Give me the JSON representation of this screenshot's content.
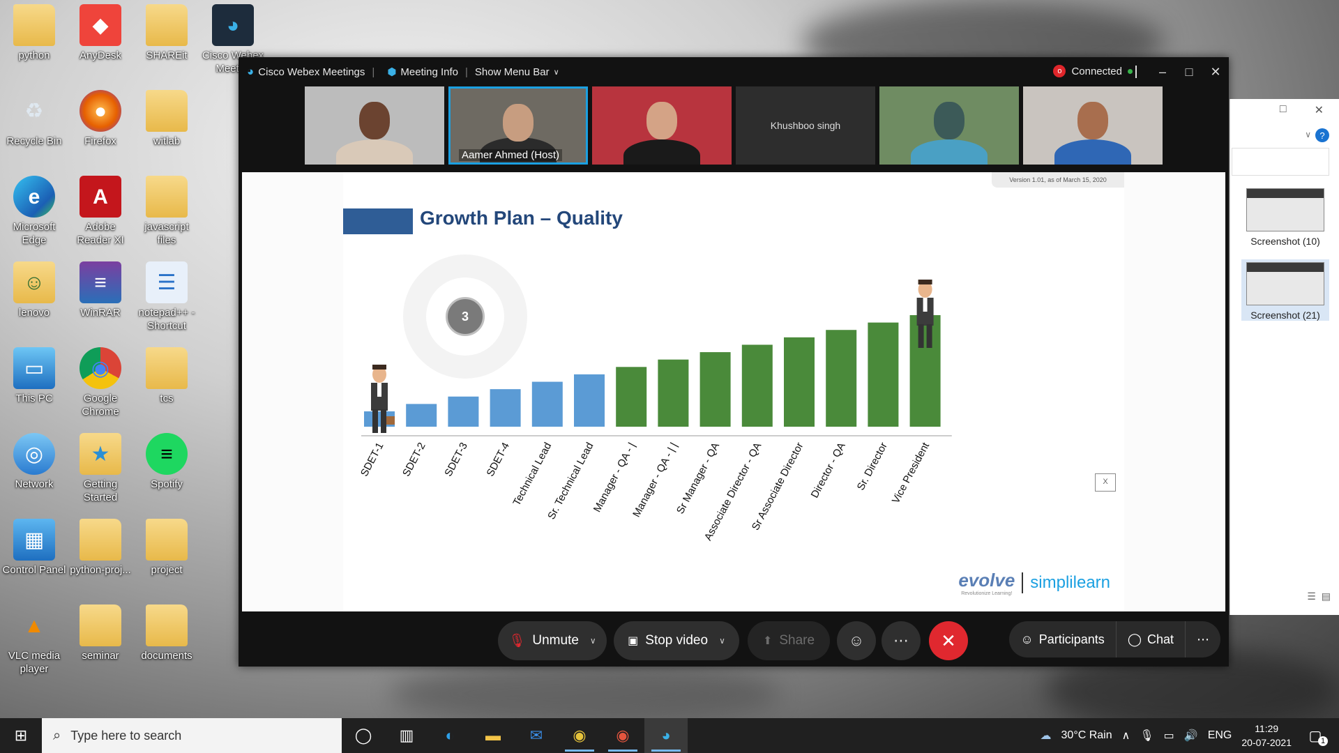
{
  "desktop": {
    "icons": [
      {
        "label": "python",
        "glyph": "folder"
      },
      {
        "label": "AnyDesk",
        "glyph": "anydesk"
      },
      {
        "label": "SHAREit",
        "glyph": "folder"
      },
      {
        "label": "Cisco Webex Meeti...",
        "glyph": "webex"
      },
      {
        "label": "Recycle Bin",
        "glyph": "recycle"
      },
      {
        "label": "Firefox",
        "glyph": "firefox"
      },
      {
        "label": "witlab",
        "glyph": "folder"
      },
      {
        "label": "Microsoft Edge",
        "glyph": "edge"
      },
      {
        "label": "Adobe Reader XI",
        "glyph": "adobe"
      },
      {
        "label": "javascript files",
        "glyph": "folder"
      },
      {
        "label": "lenovo",
        "glyph": "user-folder"
      },
      {
        "label": "WinRAR",
        "glyph": "winrar"
      },
      {
        "label": "notepad++ - Shortcut",
        "glyph": "notepad"
      },
      {
        "label": "This PC",
        "glyph": "pc"
      },
      {
        "label": "Google Chrome",
        "glyph": "chrome"
      },
      {
        "label": "tcs",
        "glyph": "folder"
      },
      {
        "label": "Network",
        "glyph": "network"
      },
      {
        "label": "Getting Started",
        "glyph": "getting-started"
      },
      {
        "label": "Spotify",
        "glyph": "spotify"
      },
      {
        "label": "Control Panel",
        "glyph": "control-panel"
      },
      {
        "label": "python-proj...",
        "glyph": "folder"
      },
      {
        "label": "project",
        "glyph": "folder"
      },
      {
        "label": "VLC media player",
        "glyph": "vlc"
      },
      {
        "label": "seminar",
        "glyph": "folder"
      },
      {
        "label": "documents",
        "glyph": "folder"
      }
    ]
  },
  "webex": {
    "app_title": "Cisco Webex Meetings",
    "meeting_info": "Meeting Info",
    "show_menu_bar": "Show Menu Bar",
    "status": "Connected",
    "rec_badge": "o",
    "participants": [
      {
        "name": "",
        "active": false
      },
      {
        "name": "Aamer Ahmed  (Host)",
        "active": true
      },
      {
        "name": "",
        "active": false
      },
      {
        "name": "Khushboo singh",
        "active": false,
        "no_video": true
      },
      {
        "name": "",
        "active": false
      },
      {
        "name": "",
        "active": false
      }
    ],
    "slide": {
      "version": "Version 1.01, as of March 15, 2020",
      "title": "Growth Plan – Quality",
      "step_badge": "3",
      "close_label": "X",
      "logo_left": "evolve",
      "logo_left_sub": "Revolutionize Learning!",
      "logo_right": "simplilearn"
    },
    "controls": {
      "unmute": "Unmute",
      "stop_video": "Stop video",
      "share": "Share",
      "participants": "Participants",
      "chat": "Chat"
    }
  },
  "chart_data": {
    "type": "bar",
    "title": "Growth Plan – Quality",
    "categories": [
      "SDET-1",
      "SDET-2",
      "SDET-3",
      "SDET-4",
      "Technical Lead",
      "Sr. Technical Lead",
      "Manager - QA - |",
      "Manager - QA - | |",
      "Sr Manager - QA",
      "Associate Director - QA",
      "Sr Associate Director",
      "Director - QA",
      "Sr. Director",
      "Vice President"
    ],
    "values": [
      2,
      3,
      4,
      5,
      6,
      7,
      8,
      9,
      10,
      11,
      12,
      13,
      14,
      15
    ],
    "series_colors": {
      "blue": "#5b9bd5",
      "green": "#4a8a3a"
    },
    "color_index": [
      "blue",
      "blue",
      "blue",
      "blue",
      "blue",
      "blue",
      "green",
      "green",
      "green",
      "green",
      "green",
      "green",
      "green",
      "green"
    ],
    "ylim": [
      0,
      16
    ],
    "grid": false,
    "legend": "none"
  },
  "side_panel": {
    "thumbs": [
      {
        "label": "Screenshot (10)",
        "selected": false
      },
      {
        "label": "Screenshot (21)",
        "selected": true
      }
    ]
  },
  "taskbar": {
    "search_placeholder": "Type here to search",
    "weather": "30°C  Rain",
    "language": "ENG",
    "time": "11:29",
    "date": "20-07-2021",
    "notifications": "1"
  }
}
